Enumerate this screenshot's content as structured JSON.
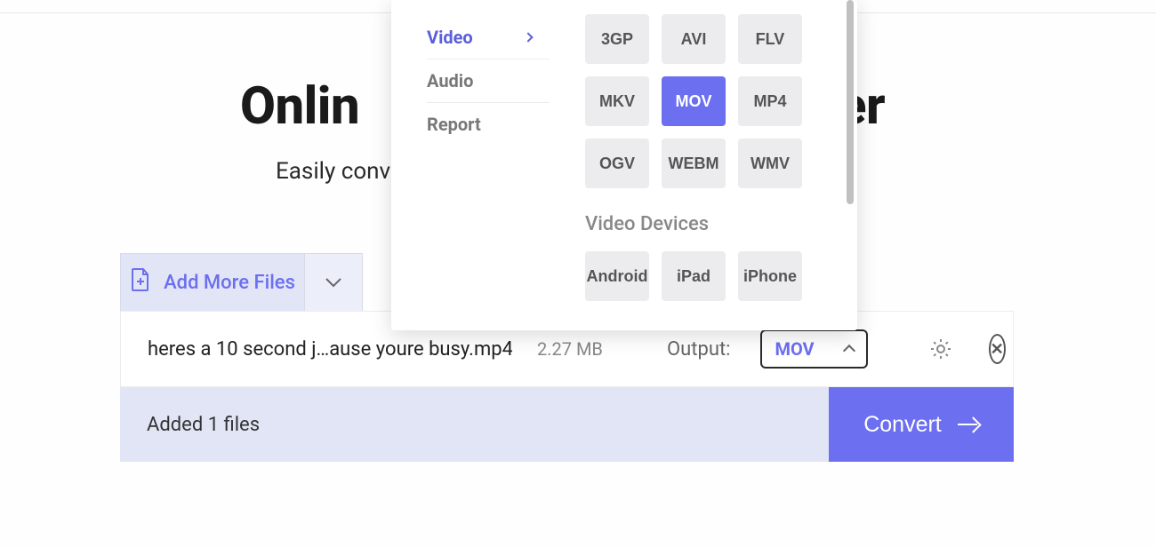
{
  "page": {
    "title_left": "Onlin",
    "title_right": "er",
    "subtitle_left": "Easily conv"
  },
  "dropdown": {
    "sidebar": {
      "video": "Video",
      "audio": "Audio",
      "report": "Report"
    },
    "formats": {
      "items": [
        "3GP",
        "AVI",
        "FLV",
        "MKV",
        "MOV",
        "MP4",
        "OGV",
        "WEBM",
        "WMV"
      ],
      "selected": "MOV"
    },
    "section_devices_label": "Video Devices",
    "devices": [
      "Android",
      "iPad",
      "iPhone"
    ]
  },
  "add_more": {
    "label": "Add More Files"
  },
  "file": {
    "name": "heres a 10 second j…ause youre busy.mp4",
    "size": "2.27 MB",
    "output_label": "Output:",
    "output_value": "MOV"
  },
  "footer": {
    "added_text": "Added 1 files",
    "convert_label": "Convert"
  }
}
